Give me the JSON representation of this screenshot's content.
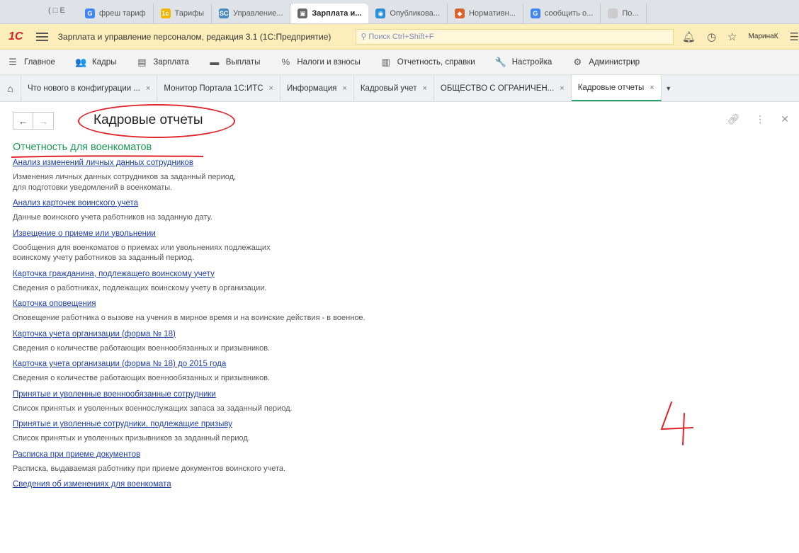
{
  "browser_tabs": [
    {
      "label": "фреш тариф",
      "fav": "G",
      "color": "#4285f4"
    },
    {
      "label": "Тарифы",
      "fav": "1c",
      "color": "#f2b600"
    },
    {
      "label": "Управление...",
      "fav": "SC",
      "color": "#4b8bbe"
    },
    {
      "label": "Зарплата и...",
      "fav": "▣",
      "color": "#666666",
      "active": true
    },
    {
      "label": "Опубликова...",
      "fav": "◉",
      "color": "#2a8fd6"
    },
    {
      "label": "Нормативн...",
      "fav": "◆",
      "color": "#d8632c"
    },
    {
      "label": "сообщить о...",
      "fav": "G",
      "color": "#4285f4"
    },
    {
      "label": "По...",
      "fav": "",
      "color": "#cccccc"
    }
  ],
  "browser_lead": "( □ E",
  "app": {
    "title": "Зарплата и управление персоналом, редакция 3.1 (1С:Предприятие)",
    "search_placeholder": "Поиск Ctrl+Shift+F",
    "user": "МаринаК",
    "logo": "1С"
  },
  "sections": [
    {
      "label": "Главное",
      "icon": "☰"
    },
    {
      "label": "Кадры",
      "icon": "👥"
    },
    {
      "label": "Зарплата",
      "icon": "▤"
    },
    {
      "label": "Выплаты",
      "icon": "▬"
    },
    {
      "label": "Налоги и взносы",
      "icon": "%"
    },
    {
      "label": "Отчетность, справки",
      "icon": "▥"
    },
    {
      "label": "Настройка",
      "icon": "🔧"
    },
    {
      "label": "Администрир",
      "icon": "⚙"
    }
  ],
  "form_tabs": [
    {
      "label": "Что нового в конфигурации ..."
    },
    {
      "label": "Монитор Портала 1С:ИТС"
    },
    {
      "label": "Информация"
    },
    {
      "label": "Кадровый учет"
    },
    {
      "label": "ОБЩЕСТВО С ОГРАНИЧЕН..."
    },
    {
      "label": "Кадровые отчеты",
      "active": true
    }
  ],
  "form": {
    "title": "Кадровые отчеты",
    "group_title": "Отчетность для военкоматов",
    "reports": [
      {
        "link": "Анализ изменений личных данных сотрудников",
        "desc": "Изменения личных данных сотрудников за заданный период,\nдля подготовки уведомлений в военкоматы."
      },
      {
        "link": "Анализ карточек воинского учета",
        "desc": "Данные воинского учета работников на заданную дату."
      },
      {
        "link": "Извещение о приеме или увольнении",
        "desc": "Сообщения для военкоматов о приемах или увольнениях подлежащих\nвоинскому учету работников за заданный период."
      },
      {
        "link": "Карточка гражданина, подлежащего воинскому учету",
        "desc": "Сведения о работниках, подлежащих воинскому учету в организации."
      },
      {
        "link": "Карточка оповещения",
        "desc": "Оповещение работника о вызове на учения в мирное время и на воинские действия - в военное."
      },
      {
        "link": "Карточка учета организации (форма № 18)",
        "desc": "Сведения о количестве работающих военнообязанных и призывников."
      },
      {
        "link": "Карточка учета организации (форма № 18) до 2015 года",
        "desc": "Сведения о количестве работающих военнообязанных и призывников."
      },
      {
        "link": "Принятые и уволенные военнообязанные сотрудники",
        "desc": "Список принятых и уволенных военнослужащих запаса за заданный период."
      },
      {
        "link": "Принятые и уволенные сотрудники, подлежащие призыву",
        "desc": "Список принятых и уволенных призывников за заданный период."
      },
      {
        "link": "Расписка при приеме документов",
        "desc": "Расписка, выдаваемая работнику при приеме документов воинского учета."
      },
      {
        "link": "Сведения об изменениях для военкомата",
        "desc": ""
      }
    ]
  },
  "colors": {
    "accent": "#22a367",
    "annotation": "#e0242c",
    "link": "#1f3fa3"
  },
  "icons": {
    "home": "home-icon",
    "back": "arrow-left-icon",
    "forward": "arrow-right-icon",
    "link": "link-icon",
    "more": "more-vertical-icon",
    "close": "close-icon"
  }
}
